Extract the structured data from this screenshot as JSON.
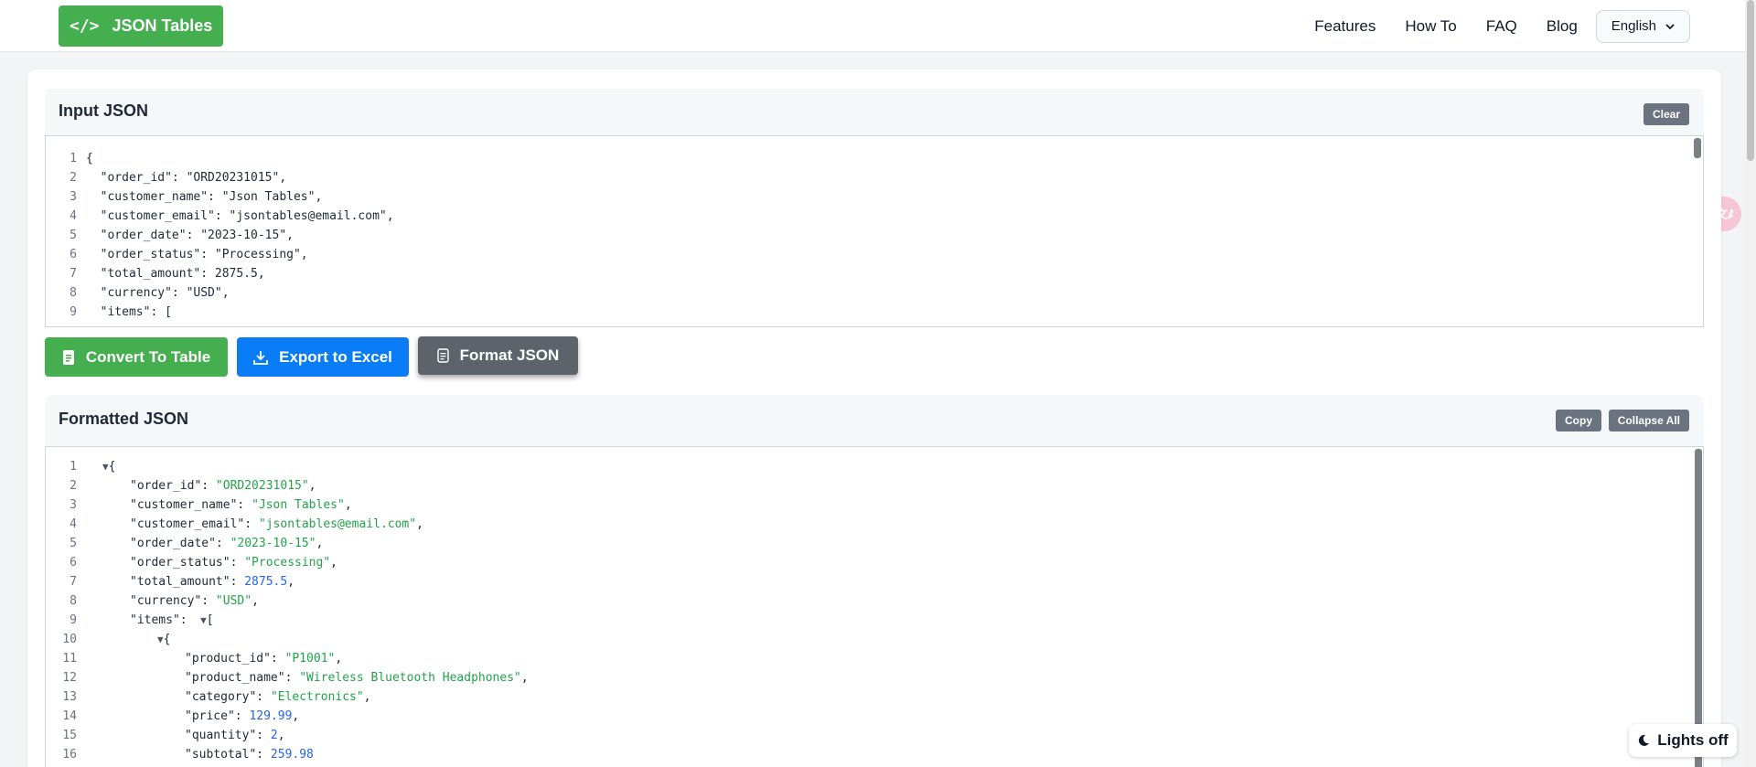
{
  "nav": {
    "logo_icon": "</>",
    "logo_text": "JSON Tables",
    "links": [
      "Features",
      "How To",
      "FAQ",
      "Blog"
    ],
    "language": "English"
  },
  "input_panel": {
    "title": "Input JSON",
    "clear_label": "Clear",
    "lines": [
      "{",
      "  \"order_id\": \"ORD20231015\",",
      "  \"customer_name\": \"Json Tables\",",
      "  \"customer_email\": \"jsontables@email.com\",",
      "  \"order_date\": \"2023-10-15\",",
      "  \"order_status\": \"Processing\",",
      "  \"total_amount\": 2875.5,",
      "  \"currency\": \"USD\",",
      "  \"items\": ["
    ]
  },
  "actions": {
    "convert": "Convert To Table",
    "export": "Export to Excel",
    "format": "Format JSON"
  },
  "formatted_panel": {
    "title": "Formatted JSON",
    "copy_label": "Copy",
    "collapse_label": "Collapse All",
    "lines": [
      {
        "indent": 0,
        "toggle": true,
        "key": "",
        "val": "{",
        "type": "punct"
      },
      {
        "indent": 1,
        "key": "order_id",
        "val": "\"ORD20231015\"",
        "type": "str",
        "comma": true
      },
      {
        "indent": 1,
        "key": "customer_name",
        "val": "\"Json Tables\"",
        "type": "str",
        "comma": true
      },
      {
        "indent": 1,
        "key": "customer_email",
        "val": "\"jsontables@email.com\"",
        "type": "str",
        "comma": true
      },
      {
        "indent": 1,
        "key": "order_date",
        "val": "\"2023-10-15\"",
        "type": "str",
        "comma": true
      },
      {
        "indent": 1,
        "key": "order_status",
        "val": "\"Processing\"",
        "type": "str",
        "comma": true
      },
      {
        "indent": 1,
        "key": "total_amount",
        "val": "2875.5",
        "type": "num",
        "comma": true
      },
      {
        "indent": 1,
        "key": "currency",
        "val": "\"USD\"",
        "type": "str",
        "comma": true
      },
      {
        "indent": 1,
        "key": "items",
        "val": "[",
        "type": "punct",
        "toggle_after": true
      },
      {
        "indent": 2,
        "toggle": true,
        "key": "",
        "val": "{",
        "type": "punct"
      },
      {
        "indent": 3,
        "key": "product_id",
        "val": "\"P1001\"",
        "type": "str",
        "comma": true
      },
      {
        "indent": 3,
        "key": "product_name",
        "val": "\"Wireless Bluetooth Headphones\"",
        "type": "str",
        "comma": true
      },
      {
        "indent": 3,
        "key": "category",
        "val": "\"Electronics\"",
        "type": "str",
        "comma": true
      },
      {
        "indent": 3,
        "key": "price",
        "val": "129.99",
        "type": "num",
        "comma": true
      },
      {
        "indent": 3,
        "key": "quantity",
        "val": "2",
        "type": "num",
        "comma": true
      },
      {
        "indent": 3,
        "key": "subtotal",
        "val": "259.98",
        "type": "num",
        "comma": false
      }
    ]
  },
  "lights_label": "Lights off",
  "translate_icon": "translate-icon"
}
